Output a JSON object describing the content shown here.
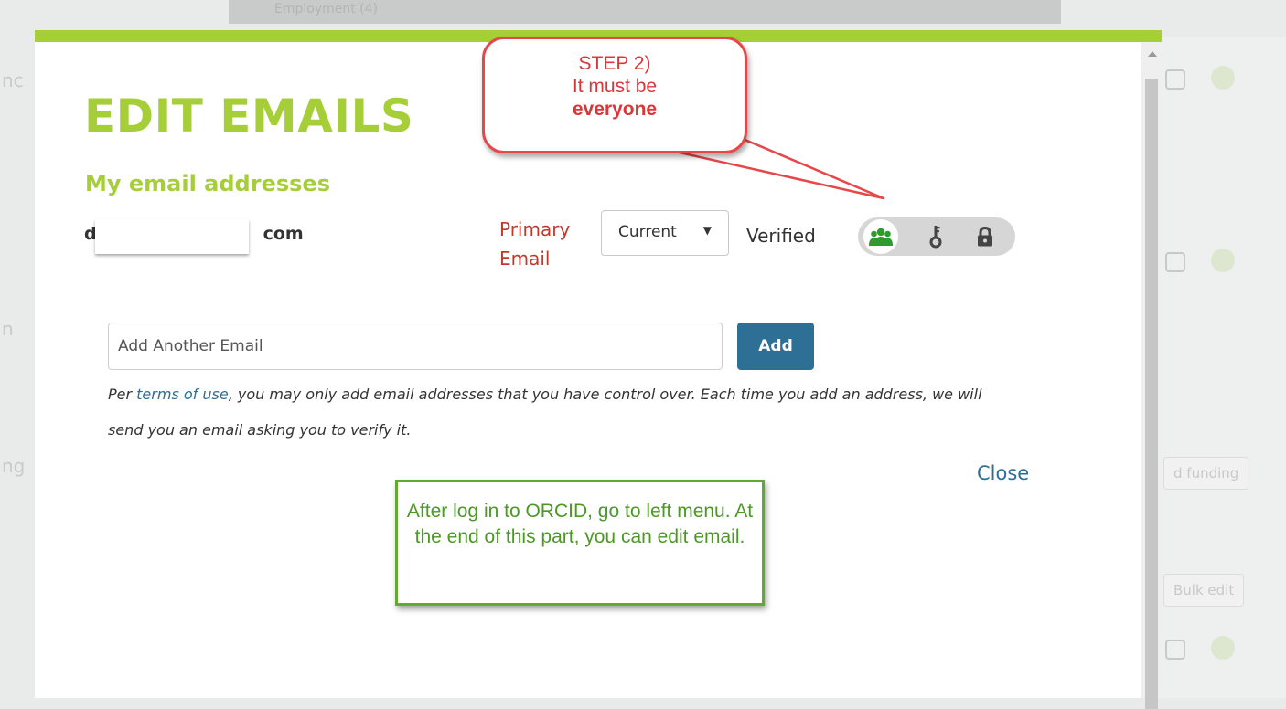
{
  "background": {
    "topbar_text": "Employment (4)",
    "left_fragments": [
      "nc",
      "n",
      "ng"
    ],
    "right_buttons": [
      "d funding",
      "Bulk edit"
    ]
  },
  "modal": {
    "title": "EDIT EMAILS",
    "subtitle": "My email addresses",
    "email": {
      "start": "d",
      "end": "com",
      "primary_label": "Primary Email",
      "status_select": {
        "value": "Current",
        "arrow": "▼"
      },
      "verified_label": "Verified",
      "privacy": {
        "selected": "everyone",
        "options": [
          "everyone-icon",
          "key-icon",
          "lock-icon"
        ]
      }
    },
    "add_email": {
      "placeholder": "Add Another Email",
      "button_label": "Add"
    },
    "notice": {
      "prefix": "Per ",
      "link_text": "terms of use",
      "suffix": ", you may only add email addresses that you have control over. Each time you add an address, we will send you an email asking you to verify it."
    },
    "close_label": "Close"
  },
  "annotations": {
    "step": {
      "line1": "STEP 2)",
      "line2": "It must be",
      "line3": "everyone"
    },
    "instruction": "After log in to ORCID, go to left menu. At the end of this part, you can edit email."
  },
  "colors": {
    "orcid_green": "#a6ce39",
    "primary_red": "#c0392b",
    "link_blue": "#2e6f96",
    "callout_red": "#e8474a",
    "callout_green": "#5fab2f",
    "everyone_icon_green": "#2e9b2e"
  }
}
